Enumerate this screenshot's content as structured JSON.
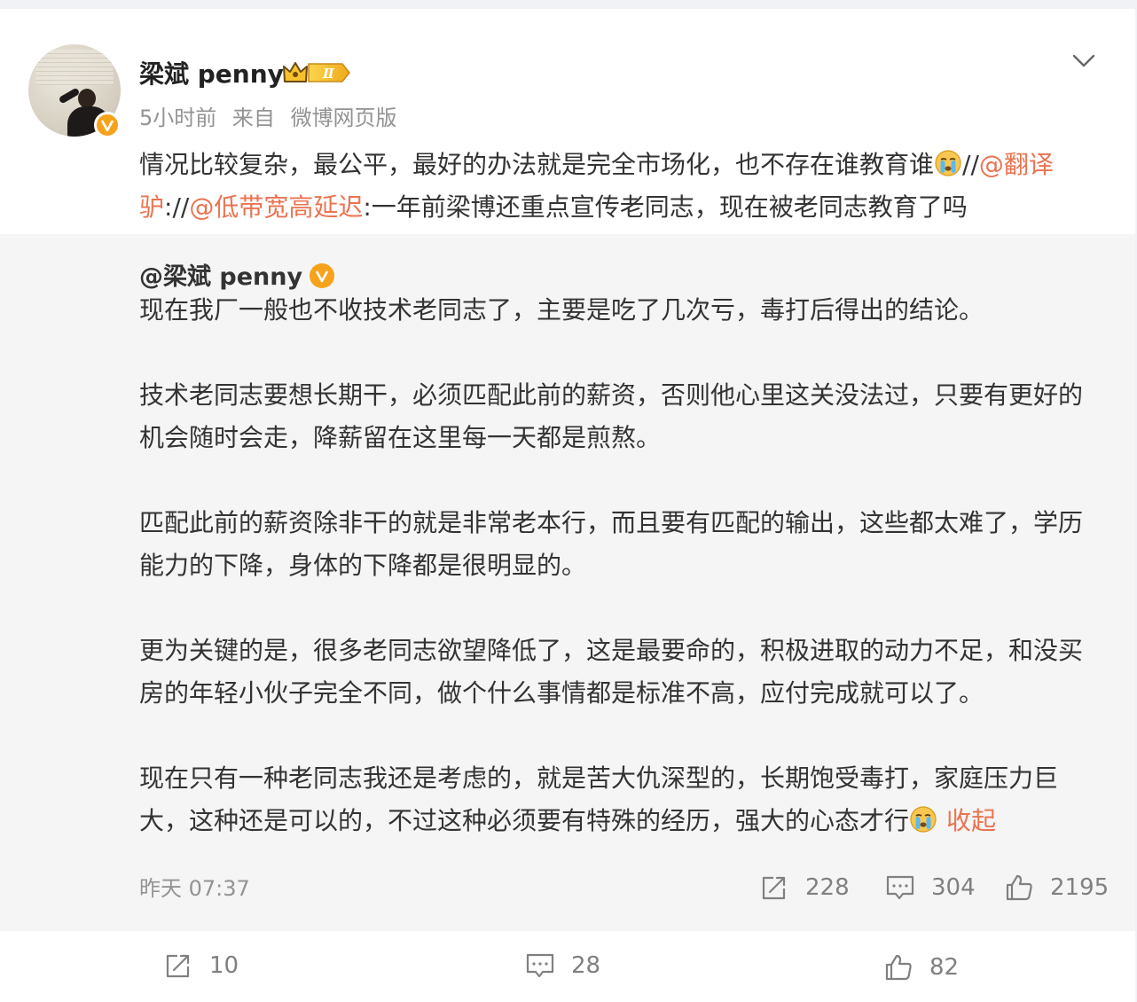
{
  "post": {
    "author": "梁斌 penny",
    "crown_level": "Ⅱ",
    "time": "5小时前",
    "source_prefix": "来自",
    "source": "微博网页版",
    "text_part1": "情况比较复杂，最公平，最好的办法就是完全市场化，也不存在谁教育谁",
    "sep1": "//",
    "mention1": "@翻译驴",
    "sep2": "://",
    "mention2": "@低带宽高延迟",
    "text_part2": ":一年前梁博还重点宣传老同志，现在被老同志教育了吗"
  },
  "repost": {
    "author": "@梁斌 penny",
    "paragraphs": [
      "现在我厂一般也不收技术老同志了，主要是吃了几次亏，毒打后得出的结论。",
      "技术老同志要想长期干，必须匹配此前的薪资，否则他心里这关没法过，只要有更好的机会随时会走，降薪留在这里每一天都是煎熬。",
      "匹配此前的薪资除非干的就是非常老本行，而且要有匹配的输出，这些都太难了，学历能力的下降，身体的下降都是很明显的。",
      "更为关键的是，很多老同志欲望降低了，这是最要命的，积极进取的动力不足，和没买房的年轻小伙子完全不同，做个什么事情都是标准不高，应付完成就可以了。",
      "现在只有一种老同志我还是考虑的，就是苦大仇深型的，长期饱受毒打，家庭压力巨大，这种还是可以的，不过这种必须要有特殊的经历，强大的心态才行"
    ],
    "collapse": "收起",
    "time": "昨天 07:37",
    "reposts": "228",
    "comments": "304",
    "likes": "2195"
  },
  "footer": {
    "reposts": "10",
    "comments": "28",
    "likes": "82"
  },
  "colors": {
    "link": "#eb7350",
    "verified": "#f7a21b",
    "meta": "#939393"
  },
  "icons": [
    "verified-badge-icon",
    "crown-level-icon",
    "chevron-down-icon",
    "crying-emoji-icon",
    "repost-icon",
    "comment-icon",
    "like-icon"
  ]
}
